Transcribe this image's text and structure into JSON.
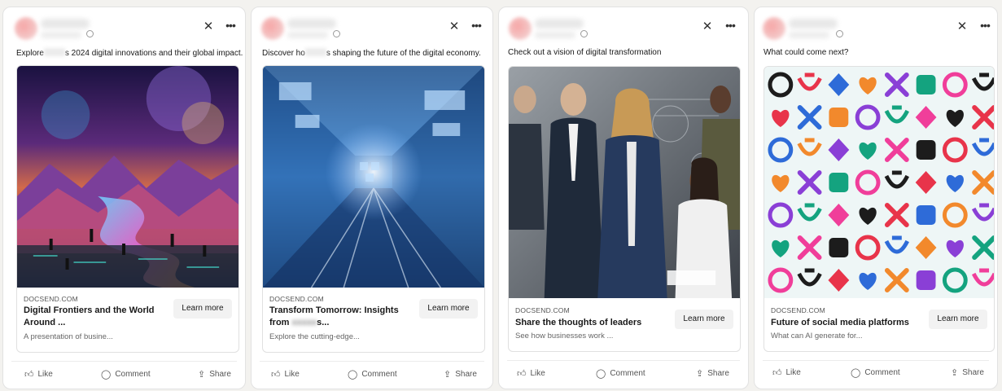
{
  "cards": [
    {
      "caption_pre": "Explore",
      "caption_post": "s 2024 digital innovations and their global impact.",
      "domain": "DOCSEND.COM",
      "headline": "Digital Frontiers and the World Around ...",
      "description": "A presentation of busine...",
      "cta": "Learn more",
      "image_icon": "digital-landscape-image"
    },
    {
      "caption_pre": "Discover ho",
      "caption_post": "s shaping the future of the digital economy.",
      "domain": "DOCSEND.COM",
      "headline_l1": "Transform Tomorrow: Insights",
      "headline_l2": "from",
      "headline_l2_tail": "s...",
      "description_pre": "Explore",
      "description_post": "the cutting-edge...",
      "cta": "Learn more",
      "image_icon": "digital-tunnel-image"
    },
    {
      "caption_pre": "Check out a vision of ",
      "caption_post": "digital transformation",
      "domain": "DOCSEND.COM",
      "headline": "Share the thoughts of leaders",
      "description": "See how businesses work ...",
      "cta": "Learn more",
      "image_icon": "business-leaders-image"
    },
    {
      "caption": "What could come next?",
      "domain": "DOCSEND.COM",
      "headline": "Future of social media platforms",
      "description": "What can AI generate for...",
      "cta": "Learn more",
      "image_icon": "logo-grid-image"
    }
  ],
  "actions": {
    "like": "Like",
    "comment": "Comment",
    "share": "Share"
  },
  "icons": {
    "close": "close-icon",
    "more": "more-icon",
    "like": "thumbs-up-icon",
    "comment": "comment-icon",
    "share": "share-icon"
  },
  "colors": {
    "card_bg": "#ffffff",
    "page_bg": "#f3f2ef",
    "button_bg": "#f2f2f2"
  }
}
